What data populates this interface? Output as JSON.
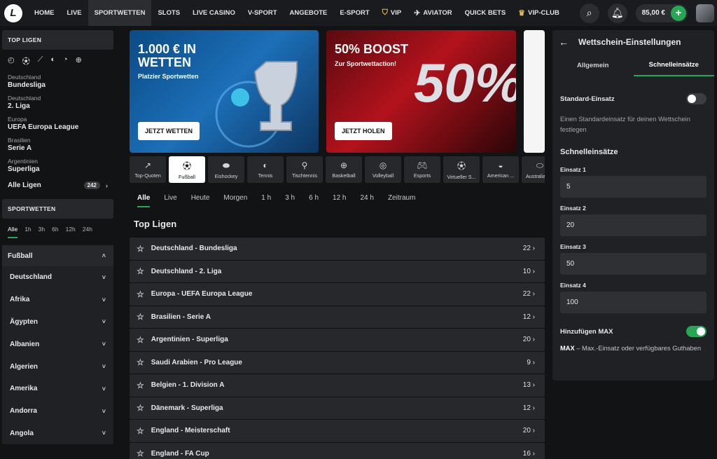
{
  "nav": {
    "logo": "L",
    "items": [
      "HOME",
      "LIVE",
      "SPORTWETTEN",
      "SLOTS",
      "LIVE CASINO",
      "V-SPORT",
      "ANGEBOTE",
      "E-SPORT",
      "VIP",
      "AVIATOR",
      "QUICK BETS",
      "VIP-CLUB"
    ],
    "active_index": 2,
    "balance": "85,00 €",
    "accent_color": "#27a753"
  },
  "sidebar": {
    "top_ligen_title": "TOP LIGEN",
    "icons": [
      "soccer-icon",
      "ball-icon",
      "hockey-icon",
      "tennis-icon",
      "tabletennis-icon",
      "basketball-icon"
    ],
    "leagues": [
      {
        "country": "Deutschland",
        "name": "Bundesliga"
      },
      {
        "country": "Deutschland",
        "name": "2. Liga"
      },
      {
        "country": "Europa",
        "name": "UEFA Europa League"
      },
      {
        "country": "Brasilien",
        "name": "Serie A"
      },
      {
        "country": "Argentinien",
        "name": "Superliga"
      }
    ],
    "alle_ligen": "Alle Ligen",
    "alle_ligen_count": "242",
    "sportwetten_title": "SPORTWETTEN",
    "filters": [
      "Alle",
      "1h",
      "3h",
      "6h",
      "12h",
      "24h"
    ],
    "sport": "Fußball",
    "countries": [
      "Deutschland",
      "Afrika",
      "Ägypten",
      "Albanien",
      "Algerien",
      "Amerika",
      "Andorra",
      "Angola"
    ]
  },
  "banners": [
    {
      "title": "1.000 € IN WETTEN",
      "subtitle": "Platzier Sportwetten",
      "button": "JETZT WETTEN"
    },
    {
      "title": "50% BOOST",
      "subtitle": "Zur Sportwettaction!",
      "button": "JETZT HOLEN",
      "bignum": "50%"
    }
  ],
  "sport_tabs": [
    "Top-Quoten",
    "Fußball",
    "Eishockey",
    "Tennis",
    "Tischtennis",
    "Basketball",
    "Volleyball",
    "Esports",
    "Virtueller S...",
    "American ...",
    "Australian ..."
  ],
  "active_sport_tab": 1,
  "time_filters": [
    "Alle",
    "Live",
    "Heute",
    "Morgen",
    "1 h",
    "3 h",
    "6 h",
    "12 h",
    "24 h",
    "Zeitraum"
  ],
  "top_ligen_heading": "Top Ligen",
  "league_rows": [
    {
      "name": "Deutschland - Bundesliga",
      "count": "22"
    },
    {
      "name": "Deutschland - 2. Liga",
      "count": "10"
    },
    {
      "name": "Europa - UEFA Europa League",
      "count": "22"
    },
    {
      "name": "Brasilien - Serie A",
      "count": "12"
    },
    {
      "name": "Argentinien - Superliga",
      "count": "20"
    },
    {
      "name": "Saudi Arabien - Pro League",
      "count": "9"
    },
    {
      "name": "Belgien - 1. Division A",
      "count": "13"
    },
    {
      "name": "Dänemark - Superliga",
      "count": "12"
    },
    {
      "name": "England - Meisterschaft",
      "count": "20"
    },
    {
      "name": "England - FA Cup",
      "count": "16"
    }
  ],
  "settings": {
    "title": "Wettschein-Einstellungen",
    "tabs": [
      "Allgemein",
      "Schnelleinsätze"
    ],
    "active_tab": 1,
    "standard_label": "Standard-Einsatz",
    "standard_desc": "Einen Standardeinsatz für deinen Wettschein festlegen",
    "standard_on": false,
    "schnell_heading": "Schnelleinsätze",
    "stakes": [
      {
        "label": "Einsatz 1",
        "value": "5"
      },
      {
        "label": "Einsatz 2",
        "value": "20"
      },
      {
        "label": "Einsatz 3",
        "value": "50"
      },
      {
        "label": "Einsatz 4",
        "value": "100"
      }
    ],
    "max_label": "Hinzufügen MAX",
    "max_on": true,
    "max_note_bold": "MAX",
    "max_note": " – Max.-Einsatz oder verfügbares Guthaben"
  }
}
